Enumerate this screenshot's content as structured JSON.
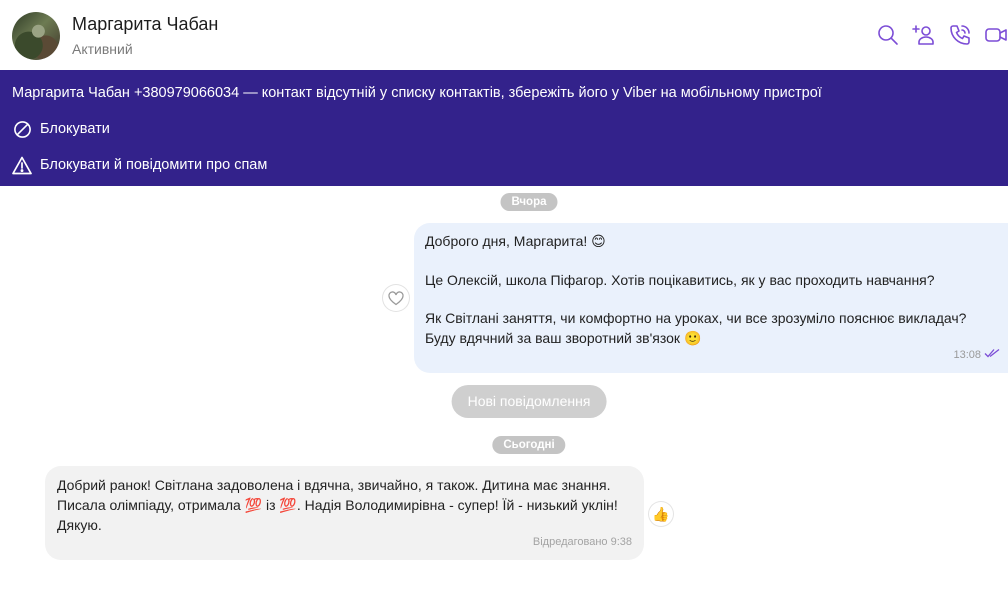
{
  "header": {
    "contact_name": "Маргарита Чабан",
    "status": "Активний",
    "actions": [
      "search-icon",
      "add-user-icon",
      "phone-icon",
      "video-icon"
    ]
  },
  "banner": {
    "notice": "Маргарита Чабан +380979066034 — контакт відсутній у списку контактів, збережіть його у Viber на мобільному пристрої",
    "block_label": "Блокувати",
    "block_spam_label": "Блокувати й повідомити про спам",
    "background": "#33228b"
  },
  "chat": {
    "date_yesterday": "Вчора",
    "date_today": "Сьогодні",
    "new_messages_label": "Нові повідомлення",
    "outgoing": {
      "line1": "Доброго дня, Маргарита! 😊",
      "line2": "Це Олексій, школа Піфагор. Хотів поцікавитись, як у вас проходить навчання?",
      "line3": "Як Світлані заняття, чи комфортно на уроках, чи все зрозуміло пояснює викладач? Буду вдячний за ваш зворотний зв'язок 🙂",
      "time": "13:08"
    },
    "incoming": {
      "text": "Добрий ранок! Світлана задоволена і вдячна, звичайно, я також. Дитина має знання. Писала олімпіаду, отримала 💯 із 💯. Надія Володимирівна - супер! Їй - низький уклін! Дякую.",
      "meta": "Відредаговано 9:38",
      "reaction": "👍"
    }
  },
  "colors": {
    "accent": "#7c4dd6",
    "outgoing_bubble": "#eaf1fc",
    "incoming_bubble": "#f2f2f2"
  }
}
